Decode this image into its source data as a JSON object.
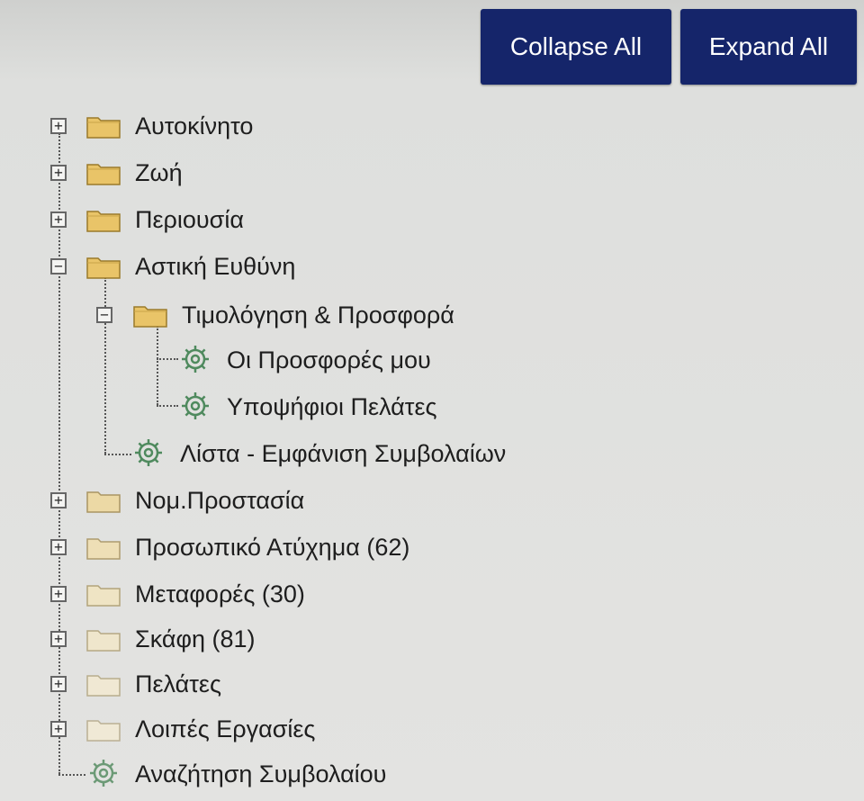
{
  "toolbar": {
    "collapse_label": "Collapse All",
    "expand_label": "Expand All"
  },
  "tree": {
    "items": [
      {
        "label": "Αυτοκίνητο",
        "type": "folder",
        "state": "collapsed"
      },
      {
        "label": "Ζωή",
        "type": "folder",
        "state": "collapsed"
      },
      {
        "label": "Περιουσία",
        "type": "folder",
        "state": "collapsed"
      },
      {
        "label": "Αστική Ευθύνη",
        "type": "folder",
        "state": "expanded",
        "children": [
          {
            "label": "Τιμολόγηση & Προσφορά",
            "type": "folder",
            "state": "expanded",
            "children": [
              {
                "label": "Οι Προσφορές μου",
                "type": "page",
                "icon": "gear-icon"
              },
              {
                "label": "Υποψήφιοι Πελάτες",
                "type": "page",
                "icon": "gear-icon"
              }
            ]
          },
          {
            "label": "Λίστα - Εμφάνιση Συμβολαίων",
            "type": "page",
            "icon": "gear-icon"
          }
        ]
      },
      {
        "label": "Νομ.Προστασία",
        "type": "folder",
        "state": "collapsed"
      },
      {
        "label": "Προσωπικό Ατύχημα (62)",
        "type": "folder",
        "state": "collapsed"
      },
      {
        "label": "Μεταφορές (30)",
        "type": "folder",
        "state": "collapsed"
      },
      {
        "label": "Σκάφη (81)",
        "type": "folder",
        "state": "collapsed"
      },
      {
        "label": "Πελάτες",
        "type": "folder",
        "state": "collapsed"
      },
      {
        "label": "Λοιπές Εργασίες",
        "type": "folder",
        "state": "collapsed"
      },
      {
        "label": "Αναζήτηση Συμβολαίου",
        "type": "page",
        "icon": "gear-icon"
      }
    ]
  },
  "colors": {
    "button_bg": "#15256a",
    "button_text": "#ffffff",
    "folder_fill": "#e9c468",
    "folder_fill_faded": "#efe4c4",
    "gear_color": "#4f8a5e"
  },
  "icons": {
    "expand_toggle": "plus-box-icon",
    "collapse_toggle": "minus-box-icon",
    "folder": "folder-icon",
    "page": "gear-icon"
  }
}
